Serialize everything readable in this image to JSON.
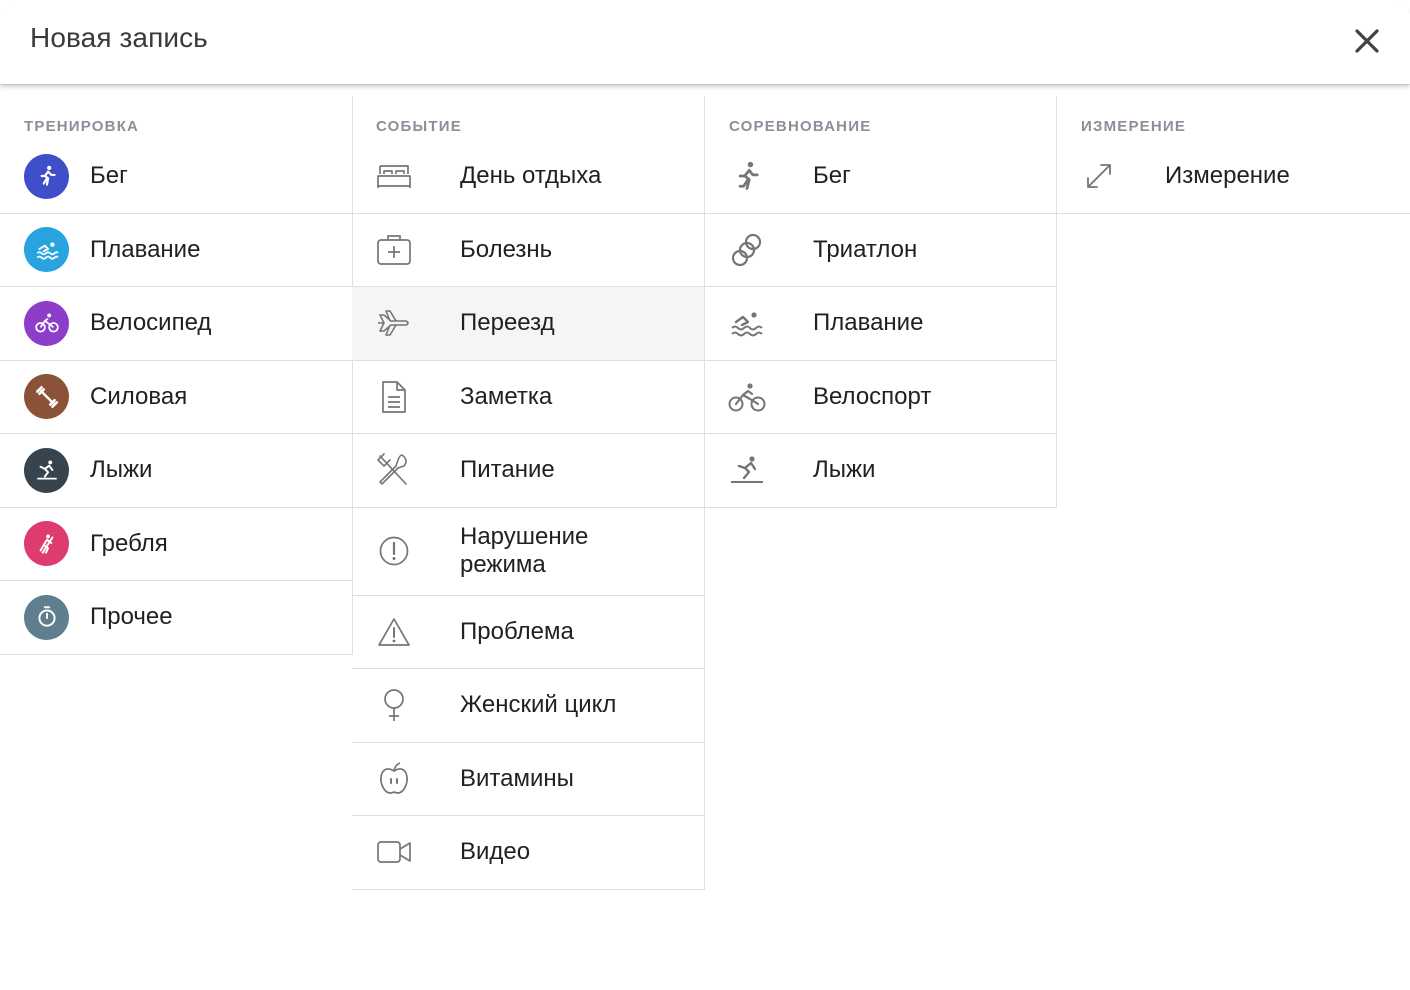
{
  "dialog": {
    "title": "Новая запись"
  },
  "columns": {
    "workout": {
      "header": "Тренировка",
      "items": [
        {
          "label": "Бег",
          "icon": "run-icon",
          "color": "#3f4ec9"
        },
        {
          "label": "Плавание",
          "icon": "swim-icon",
          "color": "#29a3e0"
        },
        {
          "label": "Велосипед",
          "icon": "bike-icon",
          "color": "#8d3ec9"
        },
        {
          "label": "Силовая",
          "icon": "dumbbell-icon",
          "color": "#8a5236"
        },
        {
          "label": "Лыжи",
          "icon": "ski-icon",
          "color": "#37434d"
        },
        {
          "label": "Гребля",
          "icon": "rowing-icon",
          "color": "#de3b6e"
        },
        {
          "label": "Прочее",
          "icon": "stopwatch-icon",
          "color": "#5f7f8f"
        }
      ]
    },
    "event": {
      "header": "Событие",
      "items": [
        {
          "label": "День отдыха",
          "icon": "bed-icon"
        },
        {
          "label": "Болезнь",
          "icon": "medkit-icon"
        },
        {
          "label": "Переезд",
          "icon": "airplane-icon"
        },
        {
          "label": "Заметка",
          "icon": "note-icon"
        },
        {
          "label": "Питание",
          "icon": "utensils-icon"
        },
        {
          "label": "Нарушение режима",
          "icon": "exclamation-circle-icon"
        },
        {
          "label": "Проблема",
          "icon": "warning-triangle-icon"
        },
        {
          "label": "Женский цикл",
          "icon": "female-icon"
        },
        {
          "label": "Витамины",
          "icon": "apple-icon"
        },
        {
          "label": "Видео",
          "icon": "video-icon"
        }
      ]
    },
    "competition": {
      "header": "Соревнование",
      "items": [
        {
          "label": "Бег",
          "icon": "run-icon"
        },
        {
          "label": "Триатлон",
          "icon": "triathlon-rings-icon"
        },
        {
          "label": "Плавание",
          "icon": "swim-icon"
        },
        {
          "label": "Велоспорт",
          "icon": "bike-icon"
        },
        {
          "label": "Лыжи",
          "icon": "ski-icon"
        }
      ]
    },
    "measurement": {
      "header": "Измерение",
      "items": [
        {
          "label": "Измерение",
          "icon": "resize-arrows-icon"
        }
      ]
    }
  },
  "colors": {
    "header_text": "#8a9099",
    "line_icon": "#757575",
    "divider": "#e0e0e0",
    "hover_row": "#f5f5f5"
  }
}
